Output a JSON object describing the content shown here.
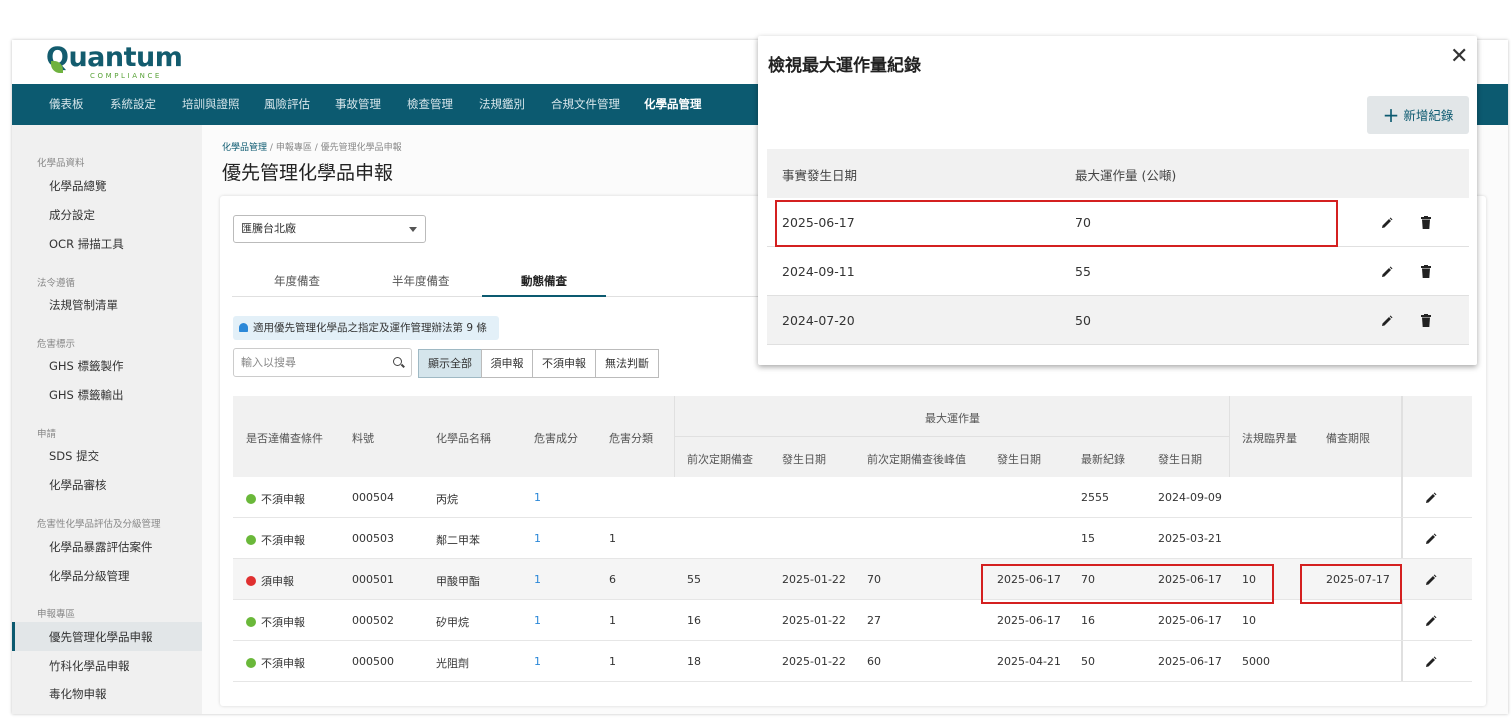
{
  "logo": {
    "word": "Quantum",
    "sub": "COMPLIANCE"
  },
  "nav": [
    "儀表板",
    "系統設定",
    "培訓與證照",
    "風險評估",
    "事故管理",
    "檢查管理",
    "法規鑑別",
    "合規文件管理",
    "化學品管理"
  ],
  "sidebar": {
    "groups": [
      {
        "label": "化學品資料",
        "items": [
          "化學品總覽",
          "成分設定",
          "OCR 掃描工具"
        ]
      },
      {
        "label": "法令遵循",
        "items": [
          "法規管制清單"
        ]
      },
      {
        "label": "危害標示",
        "items": [
          "GHS 標籤製作",
          "GHS 標籤輸出"
        ]
      },
      {
        "label": "申請",
        "items": [
          "SDS 提交",
          "化學品審核"
        ]
      },
      {
        "label": "危害性化學品評估及分級管理",
        "items": [
          "化學品暴露評估案件",
          "化學品分級管理"
        ]
      },
      {
        "label": "申報專區",
        "items": [
          "優先管理化學品申報",
          "竹科化學品申報",
          "毒化物申報"
        ]
      }
    ]
  },
  "breadcrumb": {
    "a": "化學品管理",
    "b": "申報專區",
    "c": "優先管理化學品申報",
    "sep": "/"
  },
  "page_title": "優先管理化學品申報",
  "factory_select": "匯騰台北廠",
  "tabs": [
    "年度備查",
    "半年度備查",
    "動態備查"
  ],
  "notice": "適用優先管理化學品之指定及運作管理辦法第 9 條",
  "search_placeholder": "輸入以搜尋",
  "filters": [
    "顯示全部",
    "須申報",
    "不須申報",
    "無法判斷"
  ],
  "table": {
    "headers": {
      "status": "是否達備查條件",
      "code": "料號",
      "name": "化學品名稱",
      "hazcomp": "危害成分",
      "hazcls": "危害分類",
      "group": "最大運作量",
      "prev": "前次定期備查",
      "date1": "發生日期",
      "peak": "前次定期備查後峰值",
      "date2": "發生日期",
      "latest": "最新紀錄",
      "date3": "發生日期",
      "threshold": "法規臨界量",
      "deadline": "備查期限"
    },
    "rows": [
      {
        "status": "不須申報",
        "color": "green",
        "code": "000504",
        "name": "丙烷",
        "hazcomp": "1",
        "hazcls": "",
        "prev": "",
        "date1": "",
        "peak": "",
        "date2": "",
        "latest": "2555",
        "date3": "2024-09-09",
        "threshold": "",
        "deadline": ""
      },
      {
        "status": "不須申報",
        "color": "green",
        "code": "000503",
        "name": "鄰二甲苯",
        "hazcomp": "1",
        "hazcls": "1",
        "prev": "",
        "date1": "",
        "peak": "",
        "date2": "",
        "latest": "15",
        "date3": "2025-03-21",
        "threshold": "",
        "deadline": ""
      },
      {
        "status": "須申報",
        "color": "red",
        "code": "000501",
        "name": "甲酸甲酯",
        "hazcomp": "1",
        "hazcls": "6",
        "prev": "55",
        "date1": "2025-01-22",
        "peak": "70",
        "date2": "2025-06-17",
        "latest": "70",
        "date3": "2025-06-17",
        "threshold": "10",
        "deadline": "2025-07-17"
      },
      {
        "status": "不須申報",
        "color": "green",
        "code": "000502",
        "name": "矽甲烷",
        "hazcomp": "1",
        "hazcls": "1",
        "prev": "16",
        "date1": "2025-01-22",
        "peak": "27",
        "date2": "2025-06-17",
        "latest": "16",
        "date3": "2025-06-17",
        "threshold": "10",
        "deadline": ""
      },
      {
        "status": "不須申報",
        "color": "green",
        "code": "000500",
        "name": "光阻劑",
        "hazcomp": "1",
        "hazcls": "1",
        "prev": "18",
        "date1": "2025-01-22",
        "peak": "60",
        "date2": "2025-04-21",
        "latest": "50",
        "date3": "2025-06-17",
        "threshold": "5000",
        "deadline": ""
      }
    ]
  },
  "modal": {
    "title": "檢視最大運作量紀錄",
    "close": "✕",
    "add_label": "新增紀錄",
    "add_icon": "+",
    "headers": {
      "date": "事實發生日期",
      "qty": "最大運作量 (公噸)"
    },
    "rows": [
      {
        "date": "2025-06-17",
        "qty": "70"
      },
      {
        "date": "2024-09-11",
        "qty": "55"
      },
      {
        "date": "2024-07-20",
        "qty": "50"
      }
    ]
  },
  "colors": {
    "nav_bg": "#0c5a70",
    "status_green": "#6ab83a",
    "status_red": "#e03030",
    "highlight": "#d42020",
    "link": "#2b88d8"
  }
}
